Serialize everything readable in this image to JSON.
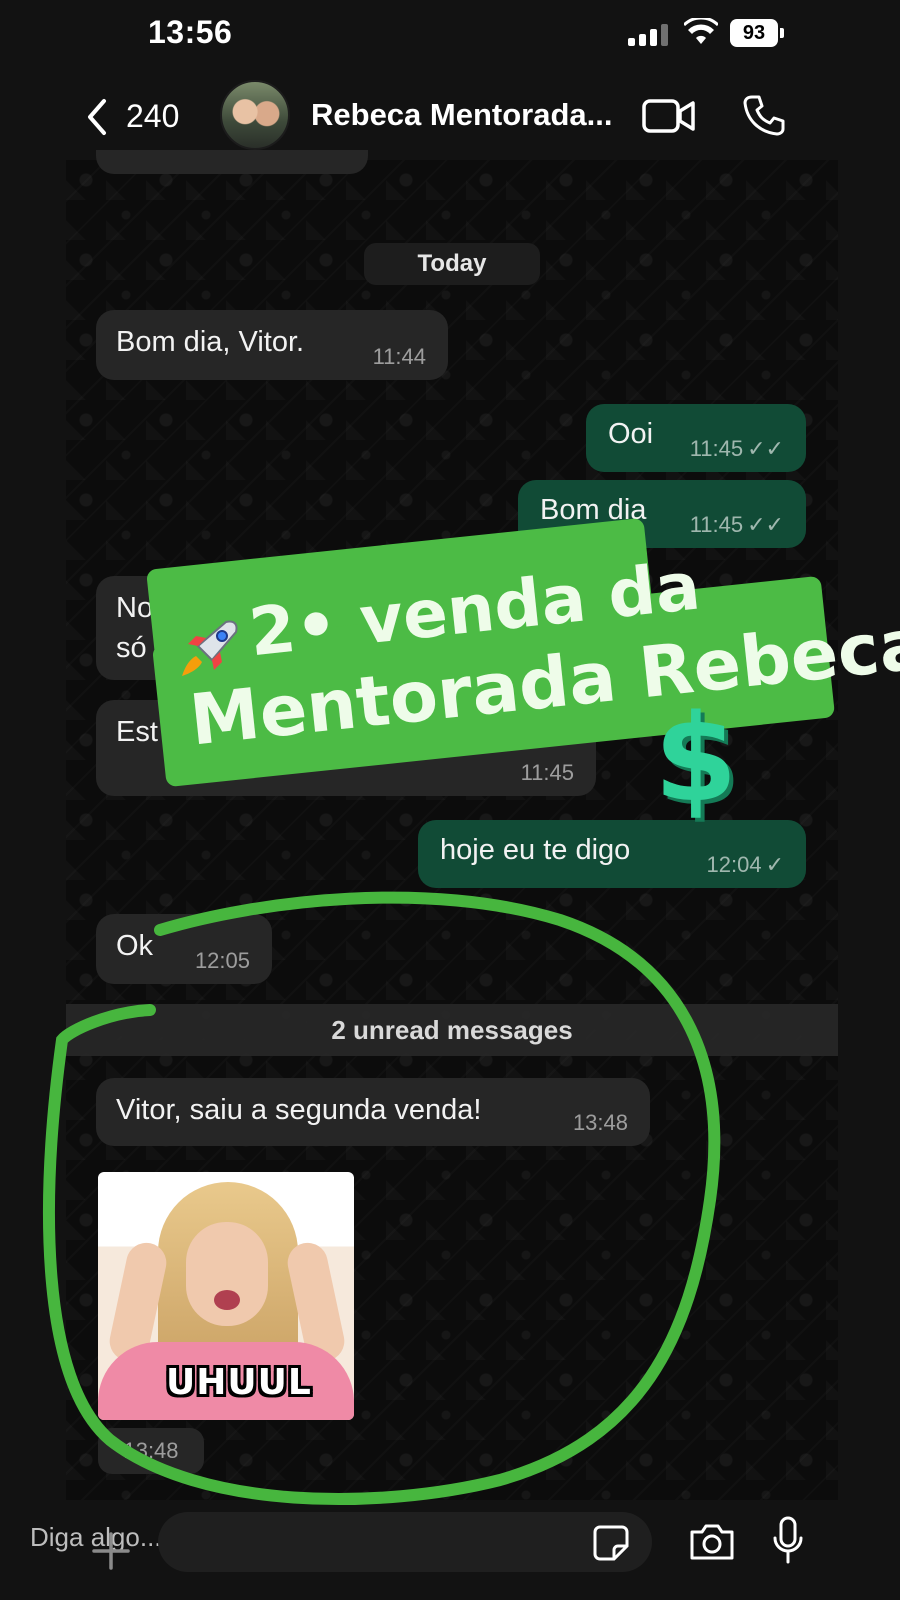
{
  "status_bar": {
    "time": "13:56",
    "battery": "93"
  },
  "header": {
    "back_count": "240",
    "contact_name": "Rebeca Mentorada..."
  },
  "day_label": "Today",
  "messages": [
    {
      "text": "Bom dia, Vitor.",
      "time": "11:44"
    },
    {
      "text": "Ooi",
      "time": "11:45",
      "ticks": "✓✓"
    },
    {
      "text": "Bom dia",
      "time": "11:45",
      "ticks": "✓✓"
    },
    {
      "text": "Nossa mentoria ime",
      "text2": "só",
      "time": ""
    },
    {
      "text": "Est",
      "time": "11:45"
    },
    {
      "text": "hoje eu te digo",
      "time": "12:04",
      "ticks": "✓"
    },
    {
      "text": "Ok",
      "time": "12:05"
    }
  ],
  "unread": "2 unread messages",
  "new_messages": [
    {
      "text": "Vitor, saiu a segunda venda!",
      "time": "13:48"
    }
  ],
  "sticker": {
    "label": "UHUUL",
    "time": "13:48"
  },
  "input": {
    "placeholder": "Diga algo..."
  },
  "promo": {
    "line1": "2• venda da",
    "line2": "Mentorada Rebeca",
    "symbol": "$"
  },
  "colors": {
    "outgoing": "#114b36",
    "incoming": "#262626",
    "promo_green": "#4cbb45",
    "ring": "#47b63e"
  }
}
